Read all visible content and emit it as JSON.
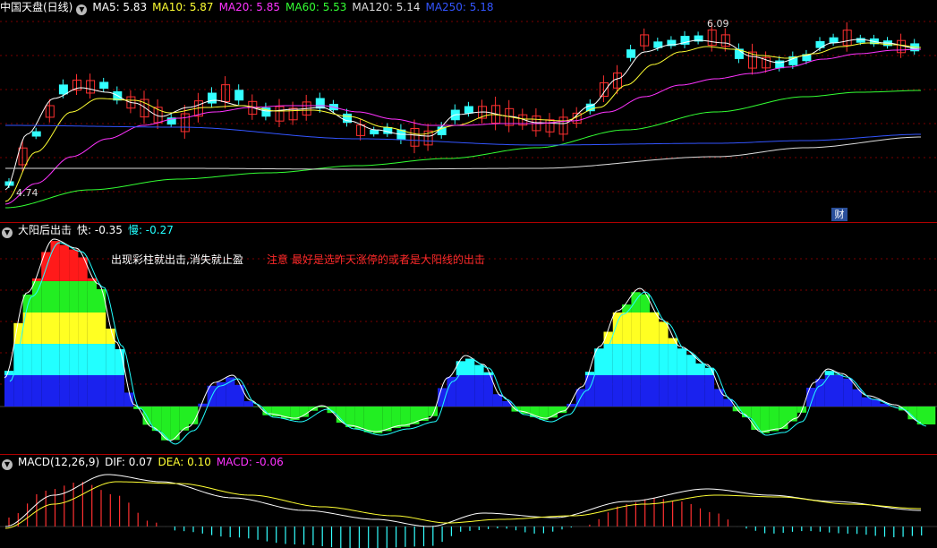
{
  "main": {
    "title": "中国天盘(日线)",
    "ma": [
      {
        "label": "MA5: 5.83",
        "color": "#ffffff"
      },
      {
        "label": "MA10: 5.87",
        "color": "#ffff33"
      },
      {
        "label": "MA20: 5.85",
        "color": "#ff33ff"
      },
      {
        "label": "MA60: 5.53",
        "color": "#33ff33"
      },
      {
        "label": "MA120: 5.14",
        "color": "#dddddd"
      },
      {
        "label": "MA250: 5.18",
        "color": "#3355ff"
      }
    ],
    "high_label": "6.09",
    "low_label": "4.74",
    "badge": "财"
  },
  "indicator": {
    "title": "大阳后出击",
    "fast_label": "快: -0.35",
    "slow_label": "慢: -0.27",
    "note1": "出现彩柱就出击,消失就止盈",
    "note2": "注意 最好是选昨天涨停的或者是大阳线的出击",
    "colors": {
      "red": "#ff1a1a",
      "green": "#22ee22",
      "yellow": "#ffff22",
      "cyan": "#22ffff",
      "blue": "#1a22ee"
    }
  },
  "macd": {
    "title": "MACD(12,26,9)",
    "dif_label": "DIF: 0.07",
    "dea_label": "DEA: 0.10",
    "macd_label": "MACD: -0.06"
  }
}
